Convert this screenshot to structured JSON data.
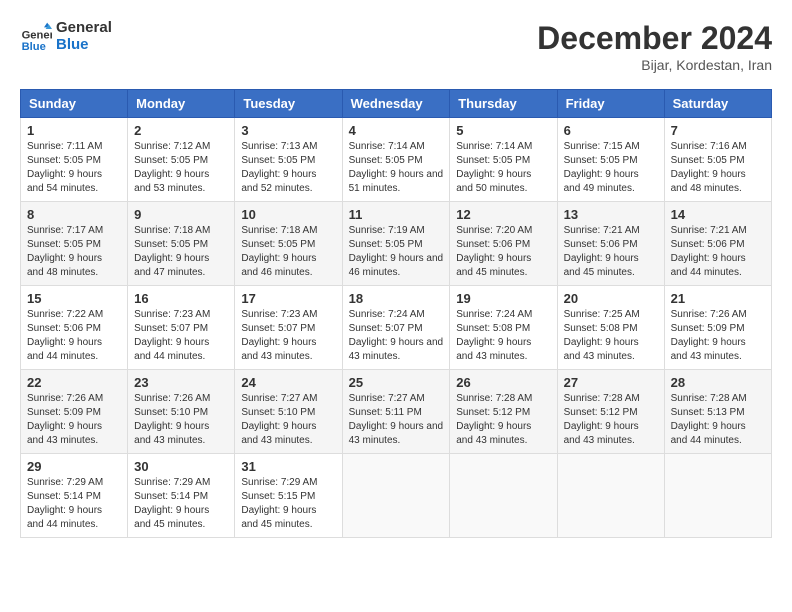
{
  "header": {
    "logo_line1": "General",
    "logo_line2": "Blue",
    "month": "December 2024",
    "location": "Bijar, Kordestan, Iran"
  },
  "weekdays": [
    "Sunday",
    "Monday",
    "Tuesday",
    "Wednesday",
    "Thursday",
    "Friday",
    "Saturday"
  ],
  "weeks": [
    [
      {
        "day": "1",
        "info": "Sunrise: 7:11 AM\nSunset: 5:05 PM\nDaylight: 9 hours and 54 minutes."
      },
      {
        "day": "2",
        "info": "Sunrise: 7:12 AM\nSunset: 5:05 PM\nDaylight: 9 hours and 53 minutes."
      },
      {
        "day": "3",
        "info": "Sunrise: 7:13 AM\nSunset: 5:05 PM\nDaylight: 9 hours and 52 minutes."
      },
      {
        "day": "4",
        "info": "Sunrise: 7:14 AM\nSunset: 5:05 PM\nDaylight: 9 hours and 51 minutes."
      },
      {
        "day": "5",
        "info": "Sunrise: 7:14 AM\nSunset: 5:05 PM\nDaylight: 9 hours and 50 minutes."
      },
      {
        "day": "6",
        "info": "Sunrise: 7:15 AM\nSunset: 5:05 PM\nDaylight: 9 hours and 49 minutes."
      },
      {
        "day": "7",
        "info": "Sunrise: 7:16 AM\nSunset: 5:05 PM\nDaylight: 9 hours and 48 minutes."
      }
    ],
    [
      {
        "day": "8",
        "info": "Sunrise: 7:17 AM\nSunset: 5:05 PM\nDaylight: 9 hours and 48 minutes."
      },
      {
        "day": "9",
        "info": "Sunrise: 7:18 AM\nSunset: 5:05 PM\nDaylight: 9 hours and 47 minutes."
      },
      {
        "day": "10",
        "info": "Sunrise: 7:18 AM\nSunset: 5:05 PM\nDaylight: 9 hours and 46 minutes."
      },
      {
        "day": "11",
        "info": "Sunrise: 7:19 AM\nSunset: 5:05 PM\nDaylight: 9 hours and 46 minutes."
      },
      {
        "day": "12",
        "info": "Sunrise: 7:20 AM\nSunset: 5:06 PM\nDaylight: 9 hours and 45 minutes."
      },
      {
        "day": "13",
        "info": "Sunrise: 7:21 AM\nSunset: 5:06 PM\nDaylight: 9 hours and 45 minutes."
      },
      {
        "day": "14",
        "info": "Sunrise: 7:21 AM\nSunset: 5:06 PM\nDaylight: 9 hours and 44 minutes."
      }
    ],
    [
      {
        "day": "15",
        "info": "Sunrise: 7:22 AM\nSunset: 5:06 PM\nDaylight: 9 hours and 44 minutes."
      },
      {
        "day": "16",
        "info": "Sunrise: 7:23 AM\nSunset: 5:07 PM\nDaylight: 9 hours and 44 minutes."
      },
      {
        "day": "17",
        "info": "Sunrise: 7:23 AM\nSunset: 5:07 PM\nDaylight: 9 hours and 43 minutes."
      },
      {
        "day": "18",
        "info": "Sunrise: 7:24 AM\nSunset: 5:07 PM\nDaylight: 9 hours and 43 minutes."
      },
      {
        "day": "19",
        "info": "Sunrise: 7:24 AM\nSunset: 5:08 PM\nDaylight: 9 hours and 43 minutes."
      },
      {
        "day": "20",
        "info": "Sunrise: 7:25 AM\nSunset: 5:08 PM\nDaylight: 9 hours and 43 minutes."
      },
      {
        "day": "21",
        "info": "Sunrise: 7:26 AM\nSunset: 5:09 PM\nDaylight: 9 hours and 43 minutes."
      }
    ],
    [
      {
        "day": "22",
        "info": "Sunrise: 7:26 AM\nSunset: 5:09 PM\nDaylight: 9 hours and 43 minutes."
      },
      {
        "day": "23",
        "info": "Sunrise: 7:26 AM\nSunset: 5:10 PM\nDaylight: 9 hours and 43 minutes."
      },
      {
        "day": "24",
        "info": "Sunrise: 7:27 AM\nSunset: 5:10 PM\nDaylight: 9 hours and 43 minutes."
      },
      {
        "day": "25",
        "info": "Sunrise: 7:27 AM\nSunset: 5:11 PM\nDaylight: 9 hours and 43 minutes."
      },
      {
        "day": "26",
        "info": "Sunrise: 7:28 AM\nSunset: 5:12 PM\nDaylight: 9 hours and 43 minutes."
      },
      {
        "day": "27",
        "info": "Sunrise: 7:28 AM\nSunset: 5:12 PM\nDaylight: 9 hours and 43 minutes."
      },
      {
        "day": "28",
        "info": "Sunrise: 7:28 AM\nSunset: 5:13 PM\nDaylight: 9 hours and 44 minutes."
      }
    ],
    [
      {
        "day": "29",
        "info": "Sunrise: 7:29 AM\nSunset: 5:14 PM\nDaylight: 9 hours and 44 minutes."
      },
      {
        "day": "30",
        "info": "Sunrise: 7:29 AM\nSunset: 5:14 PM\nDaylight: 9 hours and 45 minutes."
      },
      {
        "day": "31",
        "info": "Sunrise: 7:29 AM\nSunset: 5:15 PM\nDaylight: 9 hours and 45 minutes."
      },
      null,
      null,
      null,
      null
    ]
  ]
}
